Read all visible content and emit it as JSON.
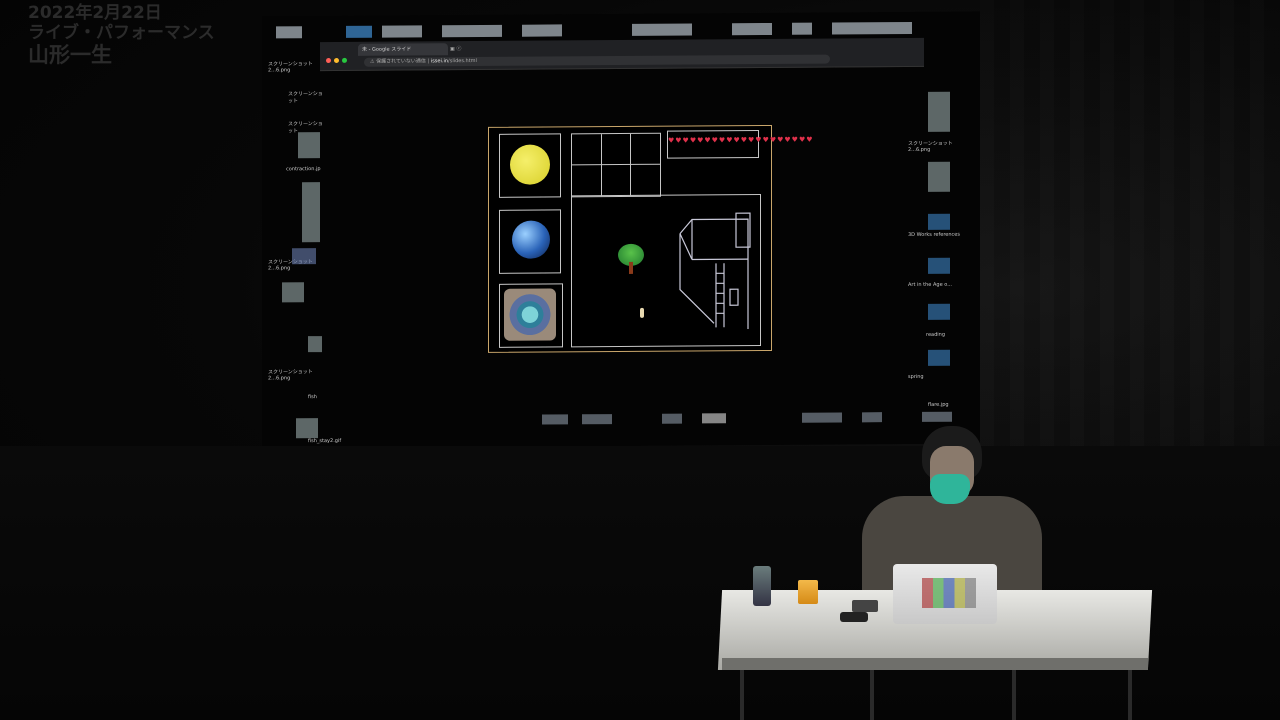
{
  "caption": {
    "line1": "2022年2月22日",
    "line2": "ライブ・パフォーマンス",
    "line3": "山形一生"
  },
  "browser": {
    "tab_title": "未 - Google スライド",
    "url_warning": "保護されていない通信",
    "url_domain": "issei.in",
    "url_path": "/slides.html"
  },
  "desktop": {
    "left_files": [
      "スクリーンショット 2...6.png",
      "スクリーンショット",
      "スクリーンショット",
      "contraction.jp",
      "スクリーンショット 2...6.png",
      "スクリーンショット 2...6.png",
      "fish",
      "fish_stay2.gif"
    ],
    "right_files": [
      "スクリーンショット 2...6.png",
      "3D Works references",
      "Art in the Age o...",
      "reading",
      "spring",
      "flare.jpg"
    ]
  },
  "slide": {
    "hearts": "♥♥♥♥♥♥♥♥♥♥♥♥♥♥♥♥♥♥♥♥"
  },
  "colors": {
    "frame": "#c9a66b",
    "mask": "#2fb59a",
    "heart": "#e0314b"
  }
}
